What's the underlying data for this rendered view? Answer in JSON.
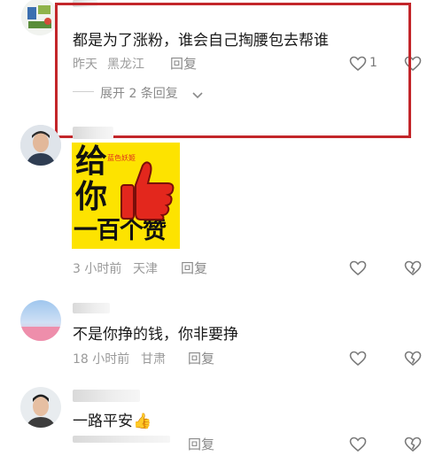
{
  "comments": [
    {
      "text": "都是为了涨粉，谁会自己掏腰包去帮谁",
      "time": "昨天",
      "location": "黑龙江",
      "reply_label": "回复",
      "like_count": "1",
      "expand_label": "展开 2 条回复"
    },
    {
      "sticker_lines": [
        "给",
        "你",
        "一百个赞"
      ],
      "sticker_caption": "蓝色妖姬",
      "time": "3 小时前",
      "location": "天津",
      "reply_label": "回复"
    },
    {
      "text": "不是你挣的钱，你非要挣",
      "time": "18 小时前",
      "location": "甘肃",
      "reply_label": "回复"
    },
    {
      "text": "一路平安👍",
      "reply_label": "回复"
    }
  ],
  "colors": {
    "highlight_border": "#c3262a",
    "sticker_bg": "#fde300",
    "thumb_red": "#e3271d",
    "meta_gray": "#9a9a9a"
  },
  "icons": [
    "heart-icon",
    "broken-heart-icon",
    "chevron-down-icon",
    "thumbs-up-icon"
  ]
}
